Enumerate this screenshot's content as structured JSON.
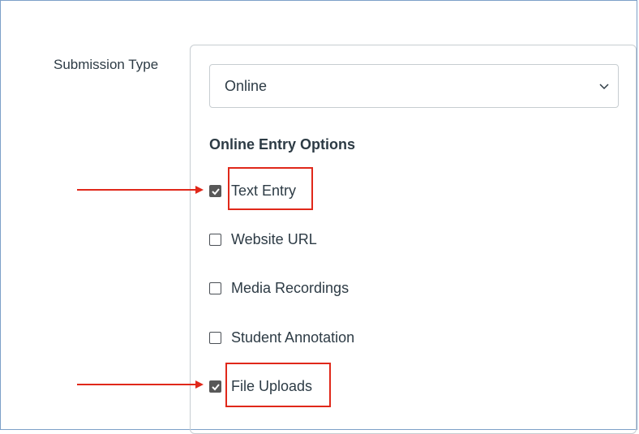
{
  "submission": {
    "label": "Submission Type",
    "select_value": "Online"
  },
  "online_entry": {
    "heading": "Online Entry Options",
    "options": [
      {
        "label": "Text Entry",
        "checked": true
      },
      {
        "label": "Website URL",
        "checked": false
      },
      {
        "label": "Media Recordings",
        "checked": false
      },
      {
        "label": "Student Annotation",
        "checked": false
      },
      {
        "label": "File Uploads",
        "checked": true
      }
    ]
  },
  "annotation_color": "#e0281a",
  "icons": [
    "chevron-down-icon",
    "checkbox-checked-icon",
    "checkbox-empty-icon",
    "arrow-right-icon"
  ]
}
